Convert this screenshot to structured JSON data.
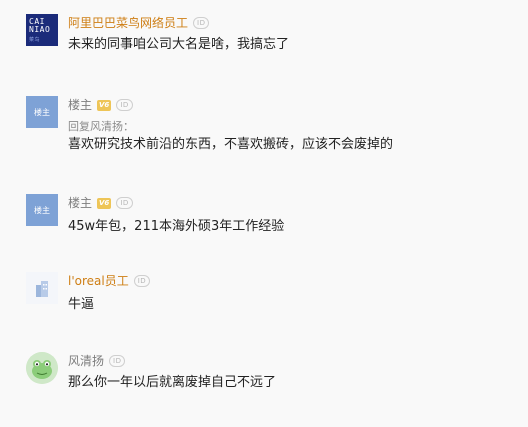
{
  "comments": [
    {
      "author": "阿里巴巴菜鸟网络员工",
      "id_badge": "ID",
      "avatar_text": "CAI NIAO",
      "avatar_sub": "菜鸟",
      "text": "未来的同事咱公司大名是啥，我搞忘了"
    },
    {
      "author": "楼主",
      "id_badge": "ID",
      "vip_badge": "V6",
      "avatar_text": "楼主",
      "quote": "回复风清扬：",
      "text": "喜欢研究技术前沿的东西，不喜欢搬砖，应该不会废掉的"
    },
    {
      "author": "楼主",
      "id_badge": "ID",
      "vip_badge": "V6",
      "avatar_text": "楼主",
      "text": "45w年包，211本海外硕3年工作经验"
    },
    {
      "author": "l'oreal员工",
      "id_badge": "ID",
      "text": "牛逼"
    },
    {
      "author": "风清扬",
      "id_badge": "ID",
      "text": "那么你一年以后就离废掉自己不远了"
    }
  ],
  "colors": {
    "background": "#f9f9f9",
    "employee_name": "#ce7e14",
    "name": "#7d7d7d",
    "text": "#222222",
    "vip_badge": "#eec557",
    "cainiao_avatar": "#1b2b7a",
    "louzhu_avatar": "#7ea2d6"
  }
}
